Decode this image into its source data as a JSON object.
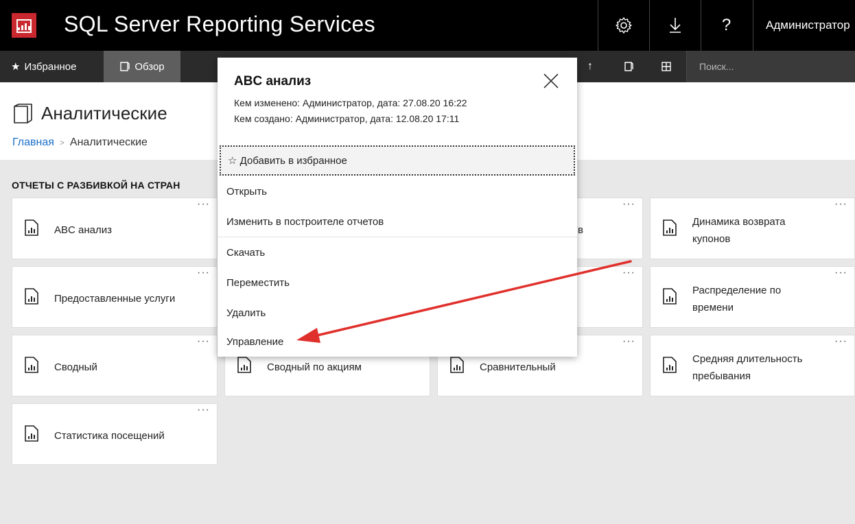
{
  "app": {
    "title": "SQL Server Reporting Services",
    "user": "Администратор",
    "settings_icon": "gear-icon",
    "download_icon": "download-icon",
    "help_label": "?"
  },
  "nav": {
    "favorites_label": "Избранное",
    "browse_label": "Обзор",
    "search_placeholder": "Поиск..."
  },
  "header": {
    "folder_title": "Аналитические",
    "breadcrumb": {
      "home": "Главная",
      "current": "Аналитические"
    }
  },
  "section_title": "ОТЧЕТЫ С РАЗБИВКОЙ НА СТРАН",
  "tiles": [
    {
      "name": "ABC анализ"
    },
    {
      "name": "в"
    },
    {
      "name": "Динамика возврата купонов"
    },
    {
      "name": "Предоставленные услуги"
    },
    {
      "name": "Распределение по времени"
    },
    {
      "name": "Сводный"
    },
    {
      "name": "Сводный по акциям"
    },
    {
      "name": "Сравнительный"
    },
    {
      "name": "Средняя длительность пребывания"
    },
    {
      "name": "Статистика посещений"
    }
  ],
  "popup": {
    "title": "ABC анализ",
    "modified": "Кем изменено: Администратор, дата: 27.08.20 16:22",
    "created": "Кем создано: Администратор, дата: 12.08.20 17:11",
    "close_label": "×",
    "menu": {
      "add_favorite": "☆ Добавить в избранное",
      "open": "Открыть",
      "edit_builder": "Изменить в построителе отчетов",
      "download": "Скачать",
      "move": "Переместить",
      "delete": "Удалить",
      "manage": "Управление"
    }
  },
  "colors": {
    "brand": "#c8282e",
    "link": "#1a6fc9",
    "arrow": "#e0302b"
  }
}
